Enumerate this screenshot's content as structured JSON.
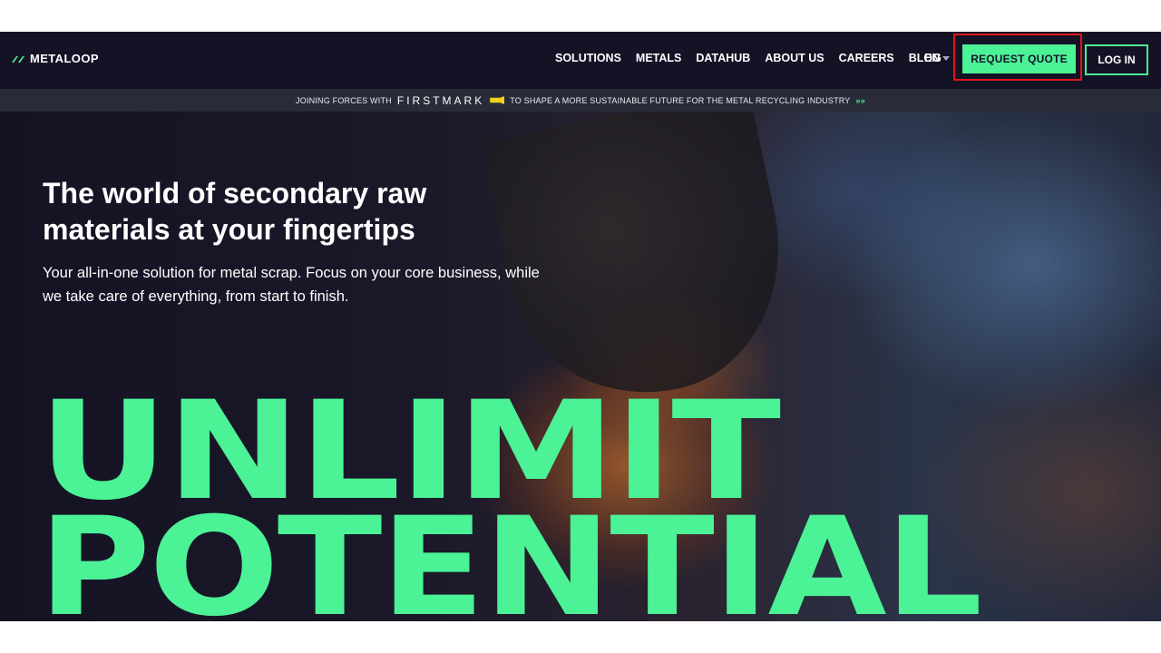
{
  "brand": {
    "name": "METALOOP"
  },
  "nav": {
    "items": [
      {
        "label": "SOLUTIONS"
      },
      {
        "label": "METALS"
      },
      {
        "label": "DATAHUB"
      },
      {
        "label": "ABOUT US"
      },
      {
        "label": "CAREERS"
      },
      {
        "label": "BLOG"
      }
    ],
    "language": "EN",
    "request_quote": "REQUEST QUOTE",
    "login": "LOG IN"
  },
  "banner": {
    "prefix": "JOINING FORCES WITH",
    "partner": "FIRSTMARK",
    "suffix": "TO SHAPE A MORE SUSTAINABLE FUTURE FOR THE METAL RECYCLING INDUSTRY",
    "arrows": "»»"
  },
  "hero": {
    "title": "The world of secondary raw materials at your fingertips",
    "subtitle": "Your all-in-one solution for metal scrap. Focus on your core business, while we take care of everything, from start to finish.",
    "big_line1": "UNLIMIT",
    "big_line2": "POTENTIAL"
  },
  "colors": {
    "accent": "#4cf296",
    "nav_bg": "#141326",
    "banner_bg": "#2a2b3a",
    "highlight": "#e0141b"
  },
  "icons": {
    "logo": "metaloop-logo-icon",
    "language_caret": "caret-down-icon",
    "partner_flag": "firstmark-flag-icon"
  }
}
